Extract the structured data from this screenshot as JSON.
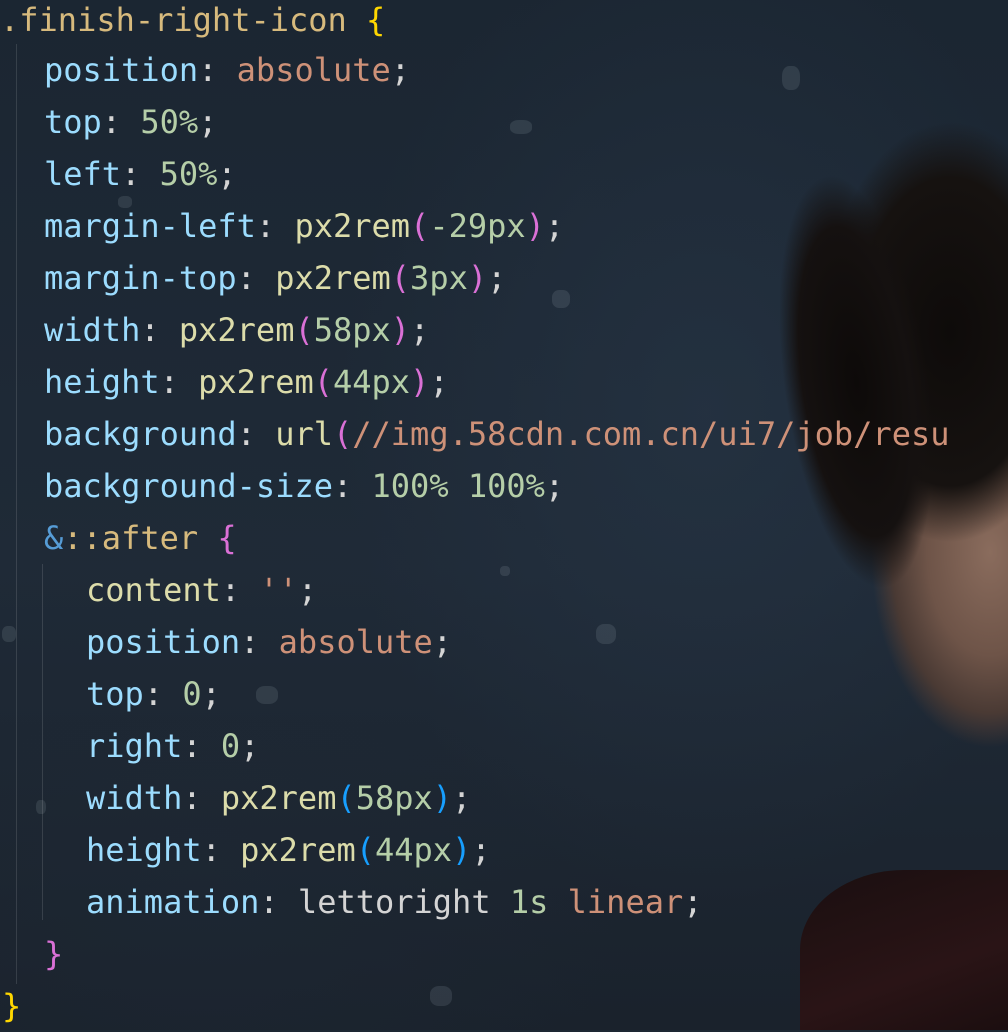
{
  "code": {
    "selector": ".finish-right-icon",
    "open_brace": "{",
    "close_brace": "}",
    "lines": [
      {
        "prop": "position",
        "value": "absolute"
      },
      {
        "prop": "top",
        "value": "50%"
      },
      {
        "prop": "left",
        "value": "50%"
      },
      {
        "prop": "margin-left",
        "fn": "px2rem",
        "arg": "-29px"
      },
      {
        "prop": "margin-top",
        "fn": "px2rem",
        "arg": "3px"
      },
      {
        "prop": "width",
        "fn": "px2rem",
        "arg": "58px"
      },
      {
        "prop": "height",
        "fn": "px2rem",
        "arg": "44px"
      },
      {
        "prop": "background",
        "fn": "url",
        "arg": "//img.58cdn.com.cn/ui7/job/resu"
      },
      {
        "prop": "background-size",
        "value": "100% 100%"
      }
    ],
    "nested": {
      "amp": "&",
      "pseudo": "::after",
      "open_brace": "{",
      "close_brace": "}",
      "lines": [
        {
          "prop": "content",
          "value": "''"
        },
        {
          "prop": "position",
          "value": "absolute"
        },
        {
          "prop": "top",
          "value": "0"
        },
        {
          "prop": "right",
          "value": "0"
        },
        {
          "prop": "width",
          "fn": "px2rem",
          "arg": "58px"
        },
        {
          "prop": "height",
          "fn": "px2rem",
          "arg": "44px"
        },
        {
          "prop": "animation",
          "value_parts": [
            "lettoright",
            "1s",
            "linear"
          ]
        }
      ]
    }
  },
  "colors": {
    "background": "#1d2733",
    "selector": "#d7ba7d",
    "property": "#9cdcfe",
    "string_value": "#ce9178",
    "number": "#b5cea8",
    "function": "#dcdcaa",
    "bracket_outer": "#ffd700",
    "bracket_inner": "#da70d6",
    "bracket_paren": "#179fff"
  }
}
